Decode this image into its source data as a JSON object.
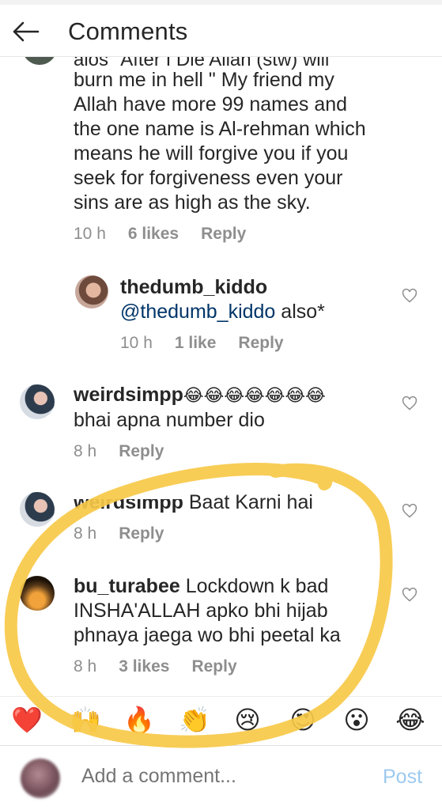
{
  "header": {
    "title": "Comments"
  },
  "clipped_line": "alos \"After I Die Allah (stw) will",
  "comments": [
    {
      "id": "c1",
      "text_lines": [
        "burn me in hell \" My friend my",
        "Allah have more 99 names and",
        "the one name is Al-rehman which",
        "means he will forgive you if you",
        "seek for forgiveness even your",
        "sins are as high as the sky."
      ],
      "time": "10 h",
      "likes": "6 likes",
      "reply": "Reply"
    },
    {
      "id": "c2",
      "username": "thedumb_kiddo",
      "mention": "@thedumb_kiddo",
      "text": " also*",
      "time": "10 h",
      "likes": "1 like",
      "reply": "Reply"
    },
    {
      "id": "c3",
      "username": "weirdsimpp",
      "emoji": "😂😂😂😂😂😂😂",
      "text": "bhai apna number dio",
      "time": "8 h",
      "reply": "Reply"
    },
    {
      "id": "c4",
      "username": "weirdsimpp",
      "text": "Baat Karni hai",
      "time": "8 h",
      "reply": "Reply"
    },
    {
      "id": "c5",
      "username": "bu_turabee",
      "text_first": "Lockdown k bad",
      "text_lines": [
        "INSHA'ALLAH apko bhi hijab",
        "phnaya jaega wo bhi peetal ka"
      ],
      "time": "8 h",
      "likes": "3 likes",
      "reply": "Reply"
    }
  ],
  "reactions": [
    "❤️",
    "🙌",
    "🔥",
    "👏",
    "😢",
    "😍",
    "😮",
    "😂"
  ],
  "compose": {
    "placeholder": "Add a comment...",
    "post": "Post"
  },
  "colors": {
    "highlight": "#f7c948",
    "link": "#003569",
    "meta": "#8e8e8e",
    "post": "#9ccaf0"
  }
}
